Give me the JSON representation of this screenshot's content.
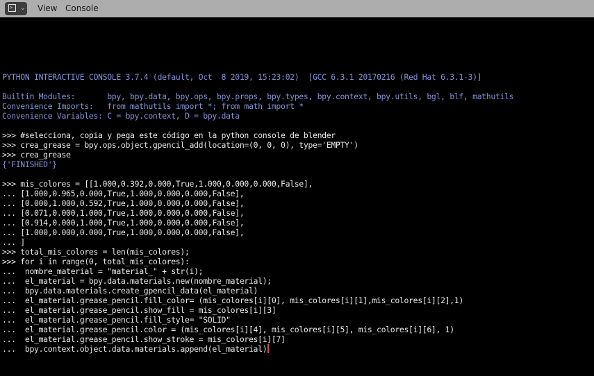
{
  "header": {
    "editor_type_icon": "python-console-icon",
    "menus": [
      {
        "label": "View"
      },
      {
        "label": "Console"
      }
    ]
  },
  "colors": {
    "output_text": "#7f92d8",
    "input_text": "#e8e8e8",
    "cursor": "#dc4c4c",
    "background": "#000000",
    "header_bg": "#adadad"
  },
  "console": {
    "lines": [
      {
        "type": "output",
        "text": "PYTHON INTERACTIVE CONSOLE 3.7.4 (default, Oct  8 2019, 15:23:02)  [GCC 6.3.1 20170216 (Red Hat 6.3.1-3)]"
      },
      {
        "type": "output",
        "text": ""
      },
      {
        "type": "output",
        "text": "Builtin Modules:       bpy, bpy.data, bpy.ops, bpy.props, bpy.types, bpy.context, bpy.utils, bgl, blf, mathutils"
      },
      {
        "type": "output",
        "text": "Convenience Imports:   from mathutils import *; from math import *"
      },
      {
        "type": "output",
        "text": "Convenience Variables: C = bpy.context, D = bpy.data"
      },
      {
        "type": "output",
        "text": ""
      },
      {
        "type": "input",
        "text": ">>> #selecciona, copia y pega este código en la python console de blender"
      },
      {
        "type": "input",
        "text": ">>> crea_grease = bpy.ops.object.gpencil_add(location=(0, 0, 0), type='EMPTY')"
      },
      {
        "type": "input",
        "text": ">>> crea_grease"
      },
      {
        "type": "output",
        "text": "{'FINISHED'}"
      },
      {
        "type": "output",
        "text": ""
      },
      {
        "type": "input",
        "text": ">>> mis_colores = [[1.000,0.392,0.000,True,1.000,0.000,0.000,False],"
      },
      {
        "type": "input",
        "text": "... [1.000,0.965,0.000,True,1.000,0.000,0.000,False],"
      },
      {
        "type": "input",
        "text": "... [0.000,1.000,0.592,True,1.000,0.000,0.000,False],"
      },
      {
        "type": "input",
        "text": "... [0.071,0.000,1.000,True,1.000,0.000,0.000,False],"
      },
      {
        "type": "input",
        "text": "... [0.914,0.000,1.000,True,1.000,0.000,0.000,False],"
      },
      {
        "type": "input",
        "text": "... [1.000,0.000,0.000,True,1.000,0.000,0.000,False],"
      },
      {
        "type": "input",
        "text": "... ]"
      },
      {
        "type": "input",
        "text": ">>> total_mis_colores = len(mis_colores);"
      },
      {
        "type": "input",
        "text": ">>> for i in range(0, total_mis_colores):"
      },
      {
        "type": "input",
        "text": "...  nombre_material = \"material_\" + str(i);"
      },
      {
        "type": "input",
        "text": "...  el_material = bpy.data.materials.new(nombre_material);"
      },
      {
        "type": "input",
        "text": "...  bpy.data.materials.create_gpencil_data(el_material)"
      },
      {
        "type": "input",
        "text": "...  el_material.grease_pencil.fill_color= (mis_colores[i][0], mis_colores[i][1],mis_colores[i][2],1)"
      },
      {
        "type": "input",
        "text": "...  el_material.grease_pencil.show_fill = mis_colores[i][3]"
      },
      {
        "type": "input",
        "text": "...  el_material.grease_pencil.fill_style= \"SOLID\""
      },
      {
        "type": "input",
        "text": "...  el_material.grease_pencil.color = (mis_colores[i][4], mis_colores[i][5], mis_colores[i][6], 1)"
      },
      {
        "type": "input",
        "text": "...  el_material.grease_pencil.show_stroke = mis_colores[i][7]"
      }
    ],
    "current_line": "...  bpy.context.object.data.materials.append(el_material)"
  }
}
